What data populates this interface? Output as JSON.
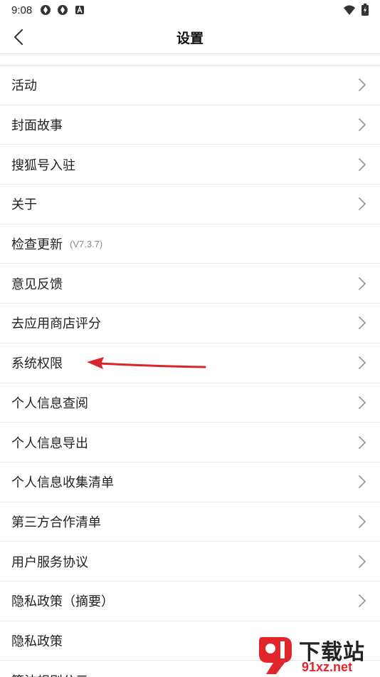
{
  "status_bar": {
    "time": "9:08"
  },
  "header": {
    "title": "设置"
  },
  "items": [
    {
      "label": "活动"
    },
    {
      "label": "封面故事"
    },
    {
      "label": "搜狐号入驻"
    },
    {
      "label": "关于"
    },
    {
      "label": "检查更新",
      "version": "(V7.3.7)"
    },
    {
      "label": "意见反馈"
    },
    {
      "label": "去应用商店评分"
    },
    {
      "label": "系统权限"
    },
    {
      "label": "个人信息查阅"
    },
    {
      "label": "个人信息导出"
    },
    {
      "label": "个人信息收集清单"
    },
    {
      "label": "第三方合作清单"
    },
    {
      "label": "用户服务协议"
    },
    {
      "label": "隐私政策（摘要）"
    },
    {
      "label": "隐私政策"
    },
    {
      "label": "算法规则公示"
    }
  ],
  "watermark": {
    "title": "下载站",
    "url": "91xz.net"
  },
  "colors": {
    "arrow": "#d9262b",
    "watermark_red": "#e0262b"
  }
}
